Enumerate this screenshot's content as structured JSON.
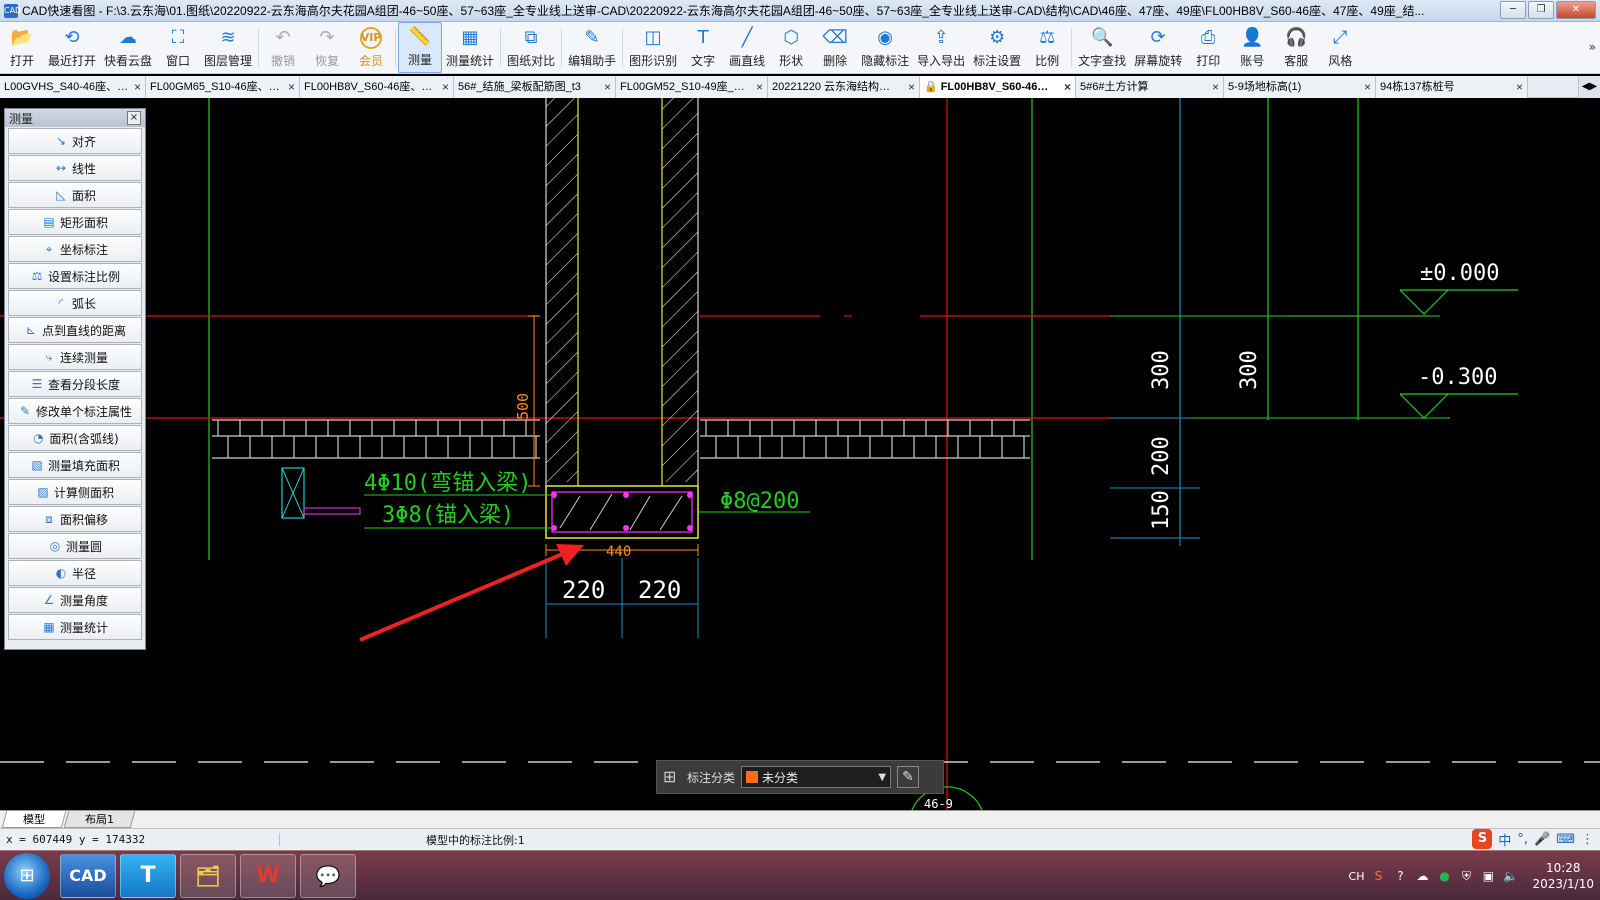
{
  "window": {
    "title": "CAD快速看图 - F:\\3.云东海\\01.图纸\\20220922-云东海高尔夫花园A组团-46~50座、57~63座_全专业线上送审-CAD\\20220922-云东海高尔夫花园A组团-46~50座、57~63座_全专业线上送审-CAD\\结构\\CAD\\46座、47座、49座\\FL00HB8V_S60-46座、47座、49座_结..."
  },
  "toolbar": {
    "items": [
      {
        "label": "打开",
        "icon": "folder-open-icon",
        "glyph": "📂",
        "state": "normal"
      },
      {
        "label": "最近打开",
        "icon": "history-icon",
        "glyph": "⟲",
        "state": "normal"
      },
      {
        "label": "快看云盘",
        "icon": "cloud-icon",
        "glyph": "☁",
        "state": "normal"
      },
      {
        "label": "窗口",
        "icon": "window-icon",
        "glyph": "⛶",
        "state": "normal"
      },
      {
        "label": "图层管理",
        "icon": "layers-icon",
        "glyph": "≋",
        "state": "normal"
      },
      {
        "label": "撤销",
        "icon": "undo-icon",
        "glyph": "↶",
        "state": "disabled"
      },
      {
        "label": "恢复",
        "icon": "redo-icon",
        "glyph": "↷",
        "state": "disabled"
      },
      {
        "label": "会员",
        "icon": "vip-icon",
        "glyph": "VIP",
        "state": "vip"
      },
      {
        "label": "测量",
        "icon": "measure-icon",
        "glyph": "📏",
        "state": "active"
      },
      {
        "label": "测量统计",
        "icon": "measure-stats-icon",
        "glyph": "▦",
        "state": "normal"
      },
      {
        "label": "图纸对比",
        "icon": "compare-icon",
        "glyph": "⧉",
        "state": "normal"
      },
      {
        "label": "编辑助手",
        "icon": "edit-assistant-icon",
        "glyph": "✎",
        "state": "normal"
      },
      {
        "label": "图形识别",
        "icon": "shape-recognize-icon",
        "glyph": "◫",
        "state": "normal"
      },
      {
        "label": "文字",
        "icon": "text-icon",
        "glyph": "T",
        "state": "normal"
      },
      {
        "label": "画直线",
        "icon": "line-icon",
        "glyph": "╱",
        "state": "normal"
      },
      {
        "label": "形状",
        "icon": "shape-icon",
        "glyph": "⬡",
        "state": "normal"
      },
      {
        "label": "删除",
        "icon": "eraser-icon",
        "glyph": "⌫",
        "state": "normal"
      },
      {
        "label": "隐藏标注",
        "icon": "eye-hide-icon",
        "glyph": "◉",
        "state": "normal"
      },
      {
        "label": "导入导出",
        "icon": "import-export-icon",
        "glyph": "⇪",
        "state": "normal"
      },
      {
        "label": "标注设置",
        "icon": "annotation-settings-icon",
        "glyph": "⚙",
        "state": "normal"
      },
      {
        "label": "比例",
        "icon": "scale-icon",
        "glyph": "⚖",
        "state": "normal"
      },
      {
        "label": "文字查找",
        "icon": "text-search-icon",
        "glyph": "🔍",
        "state": "normal"
      },
      {
        "label": "屏幕旋转",
        "icon": "rotate-screen-icon",
        "glyph": "⟳",
        "state": "normal"
      },
      {
        "label": "打印",
        "icon": "print-icon",
        "glyph": "⎙",
        "state": "normal"
      },
      {
        "label": "账号",
        "icon": "account-icon",
        "glyph": "👤",
        "state": "normal"
      },
      {
        "label": "客服",
        "icon": "headset-icon",
        "glyph": "🎧",
        "state": "normal"
      },
      {
        "label": "风格",
        "icon": "style-icon",
        "glyph": "⤢",
        "state": "normal"
      }
    ],
    "more": "»"
  },
  "tabs": [
    {
      "label": "L00GVHS_S40-46座、…",
      "active": false,
      "width": 146
    },
    {
      "label": "FL00GM65_S10-46座、…",
      "active": false,
      "width": 154
    },
    {
      "label": "FL00HB8V_S60-46座、…",
      "active": false,
      "width": 154
    },
    {
      "label": "56#_结施_梁板配筋图_t3",
      "active": false,
      "width": 162
    },
    {
      "label": "FL00GM52_S10-49座_…",
      "active": false,
      "width": 152
    },
    {
      "label": "20221220 云东海结构…",
      "active": false,
      "width": 152
    },
    {
      "label": "FL00HB8V_S60-46…",
      "active": true,
      "width": 156,
      "lock": "🔒"
    },
    {
      "label": "5#6#土方计算",
      "active": false,
      "width": 148
    },
    {
      "label": "5-9场地标高(1)",
      "active": false,
      "width": 152
    },
    {
      "label": "94栋137栋桩号",
      "active": false,
      "width": 152
    }
  ],
  "tab_nav": "◀▶",
  "panel": {
    "title": "测量",
    "close": "×",
    "items": [
      {
        "label": "对齐",
        "icon": "align-measure-icon",
        "glyph": "↘"
      },
      {
        "label": "线性",
        "icon": "linear-measure-icon",
        "glyph": "↔"
      },
      {
        "label": "面积",
        "icon": "area-measure-icon",
        "glyph": "◺"
      },
      {
        "label": "矩形面积",
        "icon": "rect-area-icon",
        "glyph": "▤"
      },
      {
        "label": "坐标标注",
        "icon": "coordinate-icon",
        "glyph": "⌖"
      },
      {
        "label": "设置标注比例",
        "icon": "set-scale-icon",
        "glyph": "⚖"
      },
      {
        "label": "弧长",
        "icon": "arc-length-icon",
        "glyph": "◜"
      },
      {
        "label": "点到直线的距离",
        "icon": "point-line-distance-icon",
        "glyph": "⊾"
      },
      {
        "label": "连续测量",
        "icon": "continuous-measure-icon",
        "glyph": "⤷"
      },
      {
        "label": "查看分段长度",
        "icon": "segment-length-icon",
        "glyph": "☰"
      },
      {
        "label": "修改单个标注属性",
        "icon": "edit-annotation-icon",
        "glyph": "✎"
      },
      {
        "label": "面积(含弧线)",
        "icon": "arc-area-icon",
        "glyph": "◔"
      },
      {
        "label": "测量填充面积",
        "icon": "fill-area-icon",
        "glyph": "▧"
      },
      {
        "label": "计算侧面积",
        "icon": "side-area-icon",
        "glyph": "▨"
      },
      {
        "label": "面积偏移",
        "icon": "area-offset-icon",
        "glyph": "⧈"
      },
      {
        "label": "测量圆",
        "icon": "circle-measure-icon",
        "glyph": "◎"
      },
      {
        "label": "半径",
        "icon": "radius-icon",
        "glyph": "◐"
      },
      {
        "label": "测量角度",
        "icon": "angle-measure-icon",
        "glyph": "∠"
      },
      {
        "label": "测量统计",
        "icon": "measure-stats-icon",
        "glyph": "▦"
      }
    ]
  },
  "drawing": {
    "elev_zero": "±0.000",
    "elev_neg": "-0.300",
    "dim_300_a": "300",
    "dim_300_b": "300",
    "dim_200": "200",
    "dim_150": "150",
    "dim_500": "500",
    "dim_440": "440",
    "dim_220_a": "220",
    "dim_220_b": "220",
    "rebar_top": "4Φ10(弯锚入梁)",
    "rebar_bottom": "3Φ8(锚入梁)",
    "stirrup": "Φ8@200",
    "grid_tag": "46-9"
  },
  "classbar": {
    "label": "标注分类",
    "selected": "未分类",
    "swatch_color": "#ff6a1a",
    "dropdown": "▼"
  },
  "layout_tabs": [
    "模型",
    "布局1"
  ],
  "status": {
    "coords": "x = 607449  y = 174332",
    "scale": "模型中的标注比例:1"
  },
  "ime": {
    "sogou": "S",
    "zh": "中",
    "punct": "°,",
    "mic": "🎤",
    "keyboard": "⌨",
    "menu": "⋮"
  },
  "taskbar": {
    "start": "⊞",
    "apps": [
      {
        "name": "cad-app",
        "label": "CAD",
        "cls": "cad"
      },
      {
        "name": "t-app",
        "label": "T",
        "cls": "t"
      },
      {
        "name": "file-explorer-app",
        "label": "🗂",
        "cls": "folder"
      },
      {
        "name": "wps-app",
        "label": "W",
        "cls": "wps"
      },
      {
        "name": "wechat-app",
        "label": "💬",
        "cls": "wechat"
      }
    ],
    "tray_lang": "CH",
    "clock_time": "10:28",
    "clock_date": "2023/1/10"
  }
}
